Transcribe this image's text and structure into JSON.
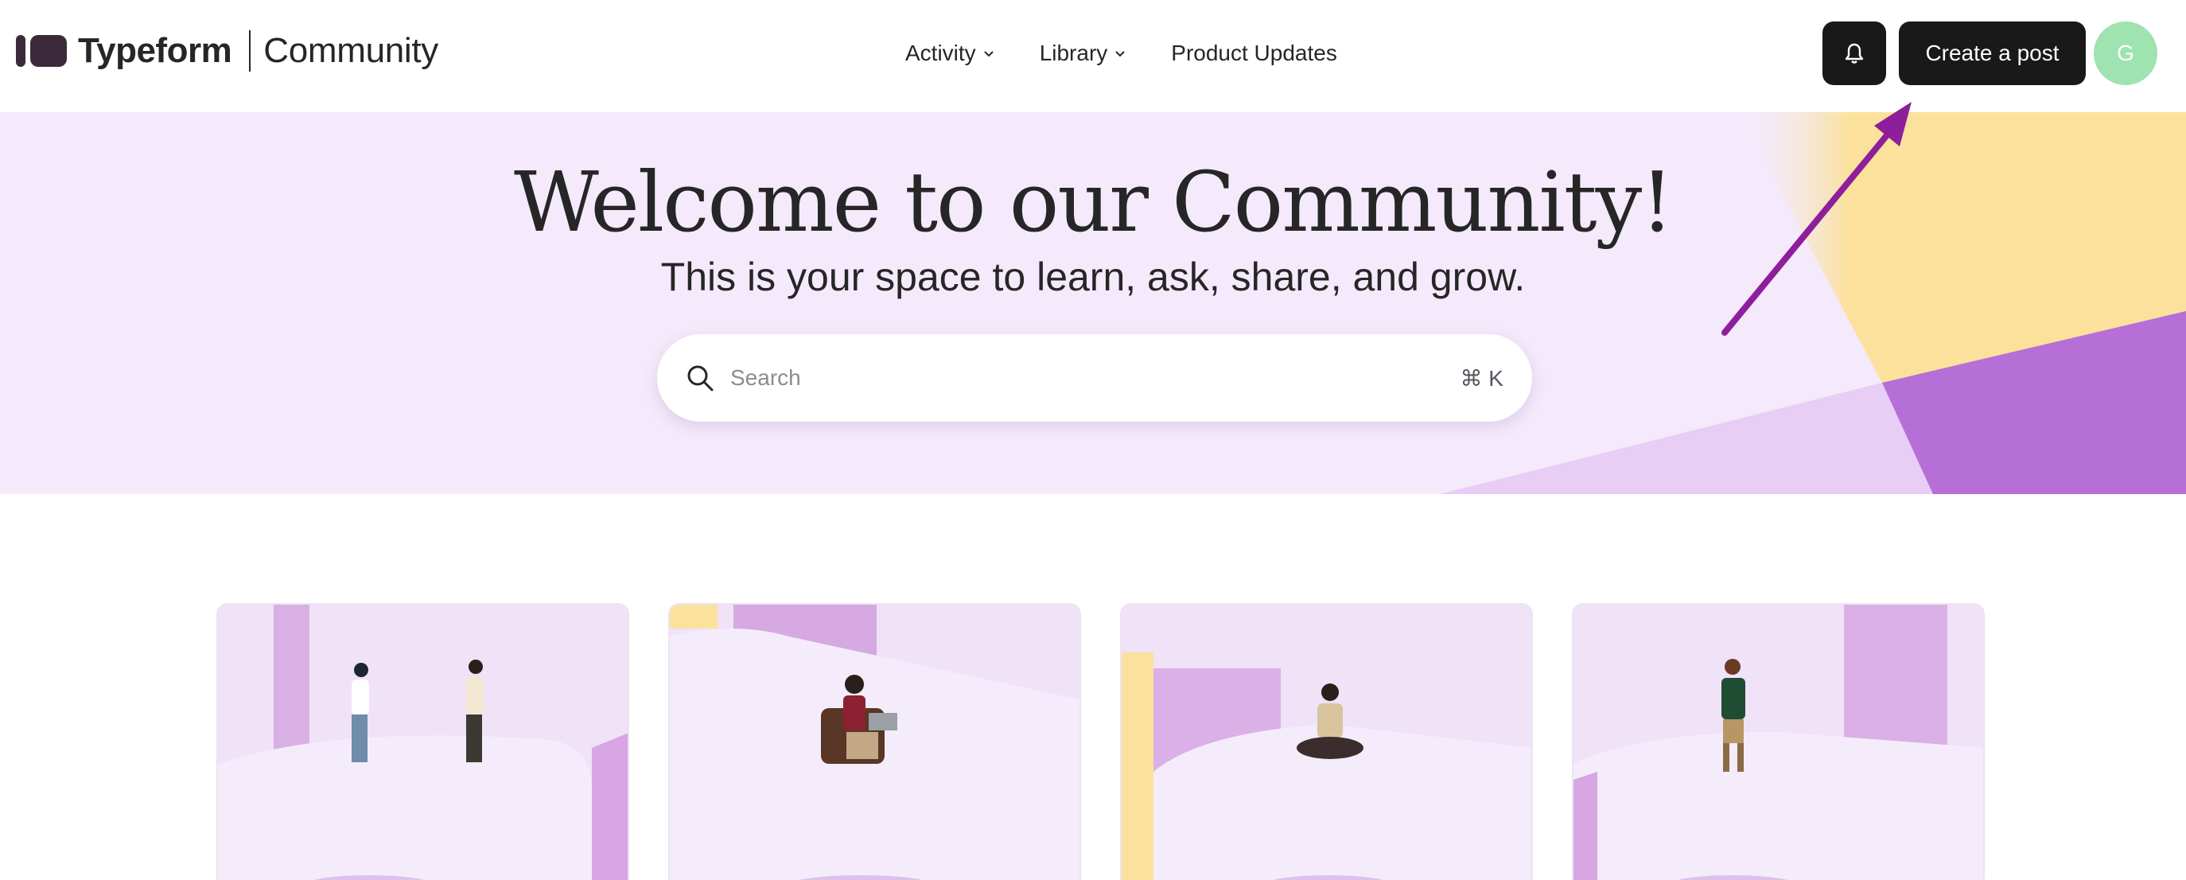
{
  "header": {
    "logo_text": "Typeform",
    "section_name": "Community",
    "nav": [
      {
        "label": "Activity",
        "has_dropdown": true
      },
      {
        "label": "Library",
        "has_dropdown": true
      },
      {
        "label": "Product Updates",
        "has_dropdown": false
      }
    ],
    "notifications_icon": "bell-icon",
    "create_post_label": "Create a post",
    "avatar_initial": "G"
  },
  "hero": {
    "title": "Welcome to our Community!",
    "subtitle": "This is your space to learn, ask, share, and grow.",
    "search": {
      "placeholder": "Search",
      "value": "",
      "shortcut": "⌘ K",
      "icon": "search-icon"
    }
  },
  "colors": {
    "hero_bg": "#f4eafb",
    "accent_purple": "#b56fd6",
    "accent_yellow": "#fbe19b",
    "arrow": "#8e1e9c",
    "button_dark": "#191919",
    "avatar_bg": "#9fe3b0"
  },
  "cards": [
    {
      "illustration": "two-people-talking-illustration"
    },
    {
      "illustration": "person-with-laptop-in-chair-illustration"
    },
    {
      "illustration": "person-sitting-with-phone-illustration"
    },
    {
      "illustration": "person-walking-illustration"
    }
  ]
}
